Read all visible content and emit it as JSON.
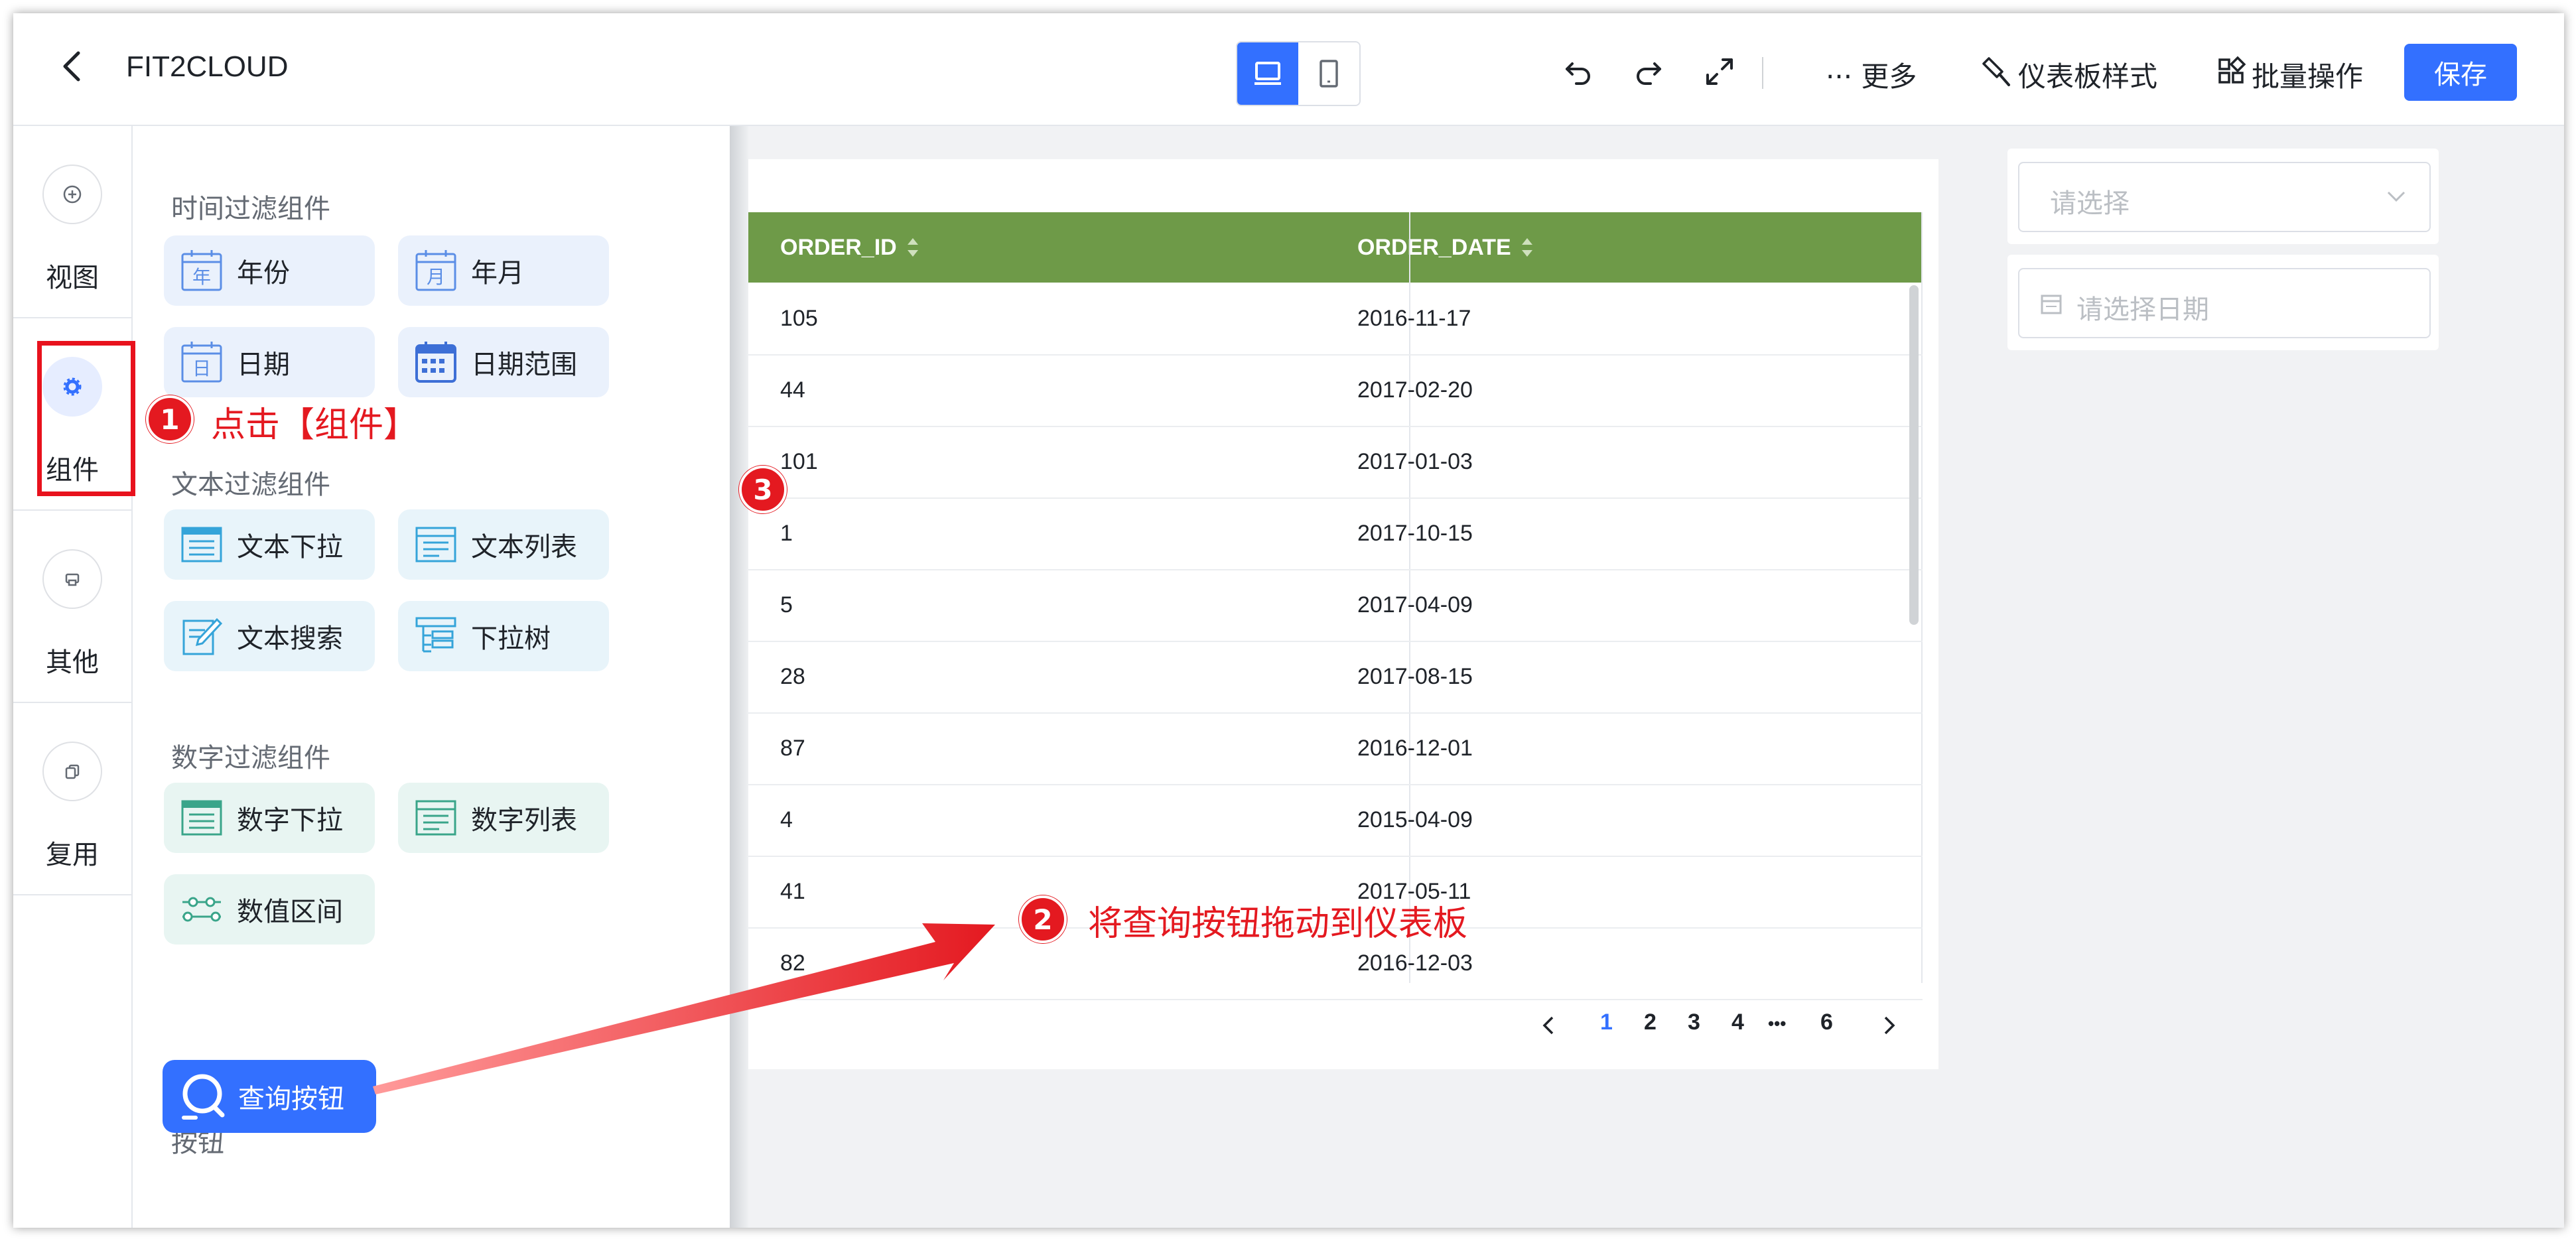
{
  "header": {
    "title": "FIT2CLOUD",
    "more_label": "··· 更多",
    "style_label": "仪表板样式",
    "batch_label": "批量操作",
    "save_label": "保存"
  },
  "leftnav": {
    "items": [
      {
        "label": "视图",
        "icon": "plus-circle-icon"
      },
      {
        "label": "组件",
        "icon": "gear-icon"
      },
      {
        "label": "其他",
        "icon": "print-icon"
      },
      {
        "label": "复用",
        "icon": "copy-icon"
      }
    ]
  },
  "panel": {
    "time_section": "时间过滤组件",
    "time_items": [
      "年份",
      "年月",
      "日期",
      "日期范围"
    ],
    "text_section": "文本过滤组件",
    "text_items": [
      "文本下拉",
      "文本列表",
      "文本搜索",
      "下拉树"
    ],
    "number_section": "数字过滤组件",
    "number_items": [
      "数字下拉",
      "数字列表",
      "数值区间"
    ],
    "button_section": "按钮",
    "query_button": "查询按钮",
    "icon_glyphs": {
      "year": "年",
      "month": "月",
      "day": "日"
    }
  },
  "table": {
    "columns": [
      "ORDER_ID",
      "ORDER_DATE"
    ],
    "rows": [
      [
        "105",
        "2016-11-17"
      ],
      [
        "44",
        "2017-02-20"
      ],
      [
        "101",
        "2017-01-03"
      ],
      [
        "1",
        "2017-10-15"
      ],
      [
        "5",
        "2017-04-09"
      ],
      [
        "28",
        "2017-08-15"
      ],
      [
        "87",
        "2016-12-01"
      ],
      [
        "4",
        "2015-04-09"
      ],
      [
        "41",
        "2017-05-11"
      ],
      [
        "82",
        "2016-12-03"
      ]
    ],
    "pagination": {
      "pages": [
        "1",
        "2",
        "3",
        "4",
        "•••",
        "6"
      ],
      "current": "1"
    }
  },
  "filters": {
    "select_placeholder": "请选择",
    "date_placeholder": "请选择日期"
  },
  "annotations": {
    "step1": "1",
    "step1_text": "点击【组件】",
    "step2": "2",
    "step2_text": "将查询按钮拖动到仪表板",
    "step3": "3"
  },
  "colors": {
    "accent": "#3370ff",
    "table_header": "#6e9a48",
    "annotation_red": "#e41920"
  }
}
